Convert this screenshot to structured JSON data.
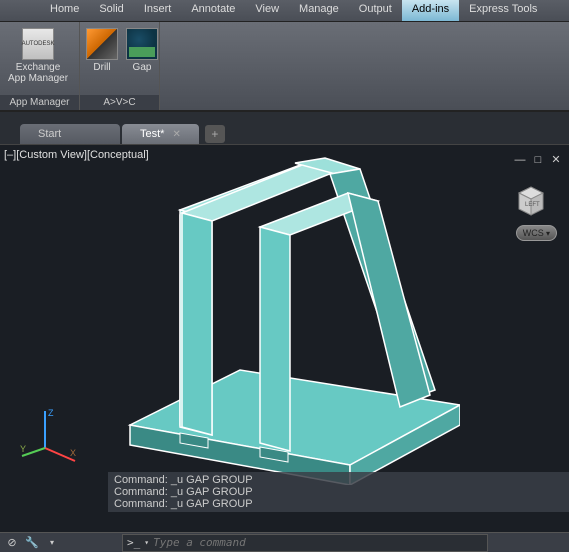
{
  "ribbon": {
    "tabs": [
      "Home",
      "Solid",
      "Insert",
      "Annotate",
      "View",
      "Manage",
      "Output",
      "Add-ins",
      "Express Tools"
    ],
    "active_tab": "Add-ins",
    "panels": [
      {
        "title": "App Manager",
        "buttons": [
          {
            "label": "Exchange\nApp Manager",
            "icon": "exchange-icon"
          }
        ]
      },
      {
        "title": "A>V>C",
        "buttons": [
          {
            "label": "Drill",
            "icon": "drill-icon"
          },
          {
            "label": "Gap",
            "icon": "gap-icon"
          }
        ]
      }
    ]
  },
  "file_tabs": {
    "tabs": [
      {
        "label": "Start",
        "active": false
      },
      {
        "label": "Test*",
        "active": true
      }
    ]
  },
  "viewport": {
    "view_label": "[–][Custom View][Conceptual]",
    "viewcube_face": "LEFT",
    "wcs_label": "WCS",
    "ucs_axes": {
      "x": "X",
      "y": "Y",
      "z": "Z"
    },
    "model": {
      "base_color": "#67c9c3",
      "dark_color": "#3a8a85",
      "edge_color": "#ffffff"
    }
  },
  "command_history": [
    "Command: _u GAP GROUP",
    "Command: _u GAP GROUP",
    "Command: _u GAP GROUP"
  ],
  "command_input": {
    "prompt_icon": ">_",
    "placeholder": "Type a command"
  },
  "status_icons": [
    "circle-slash-icon",
    "wrench-icon"
  ]
}
